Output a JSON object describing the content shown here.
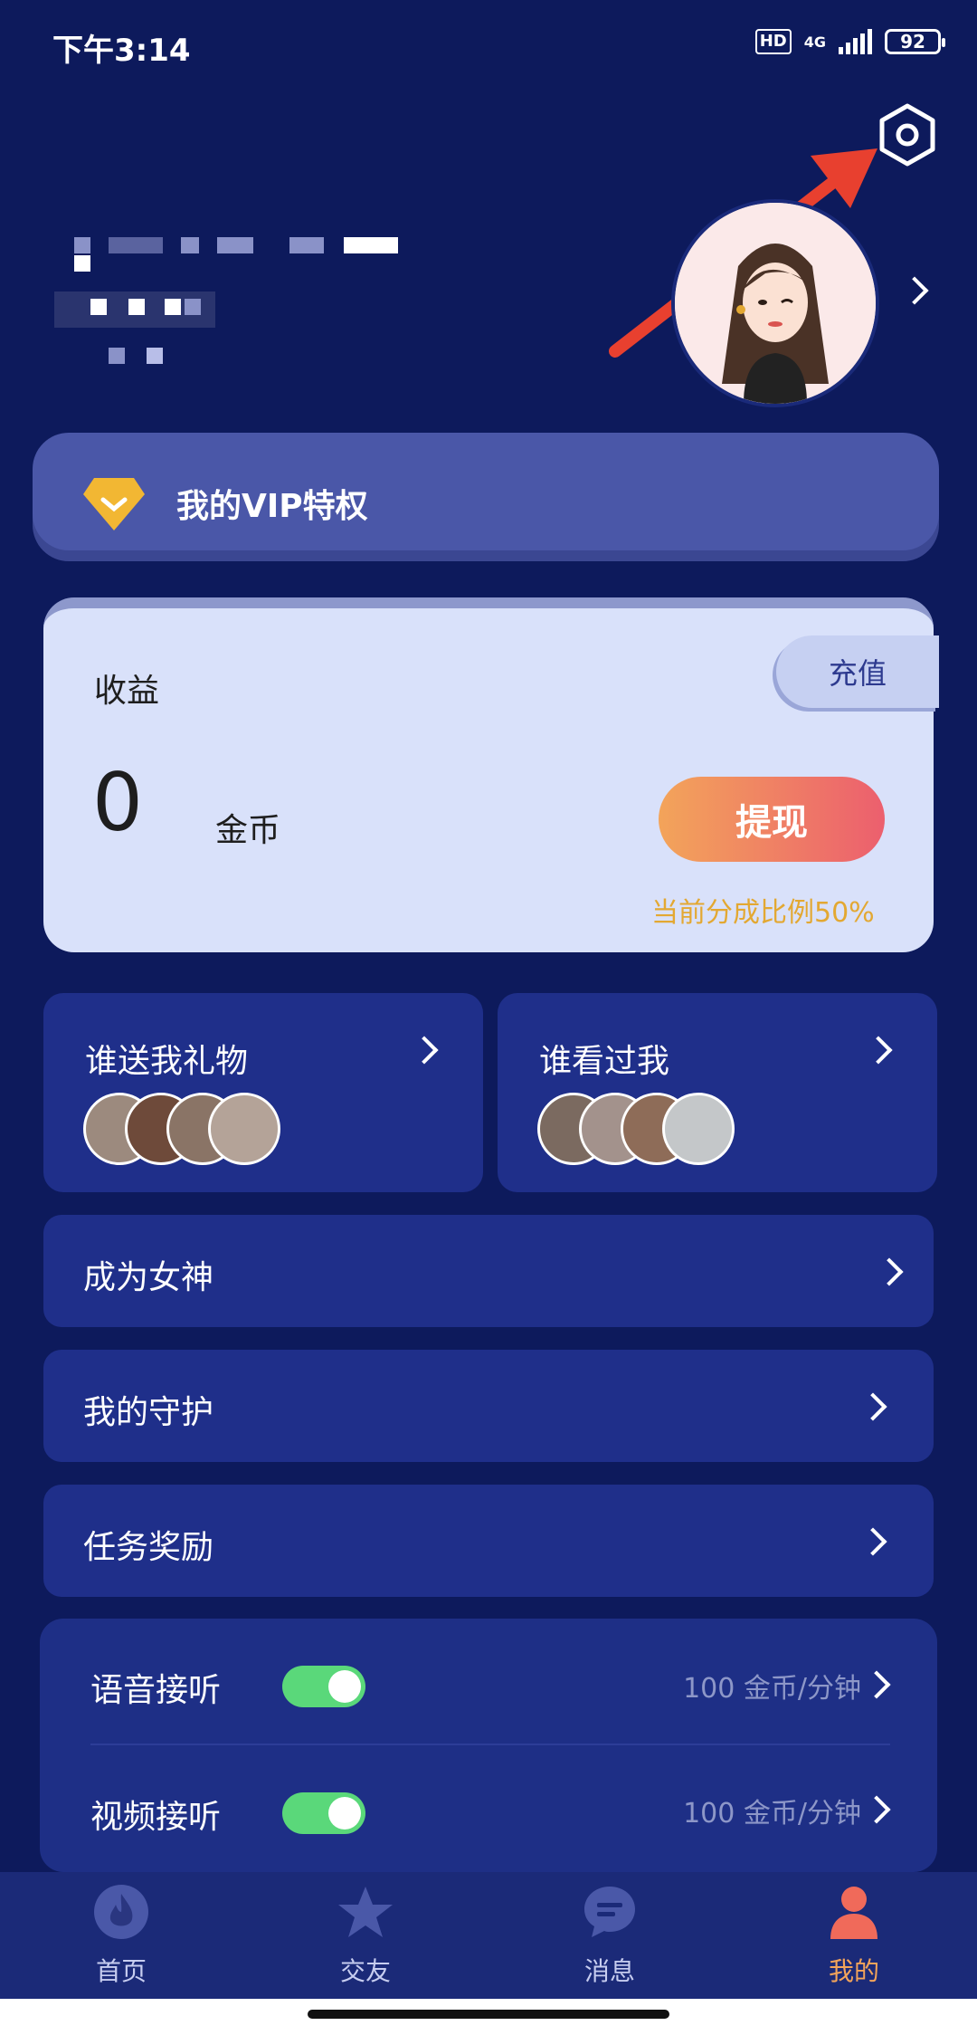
{
  "status": {
    "time": "下午3:14",
    "hd": "HD",
    "network": "4G",
    "battery": "92"
  },
  "vip": {
    "label": "我的VIP特权"
  },
  "earnings": {
    "title": "收益",
    "value": "0",
    "unit": "金币",
    "recharge_label": "充值",
    "withdraw_label": "提现",
    "share_ratio": "当前分成比例50%"
  },
  "cards": [
    {
      "title": "谁送我礼物"
    },
    {
      "title": "谁看过我"
    }
  ],
  "rows": [
    {
      "label": "成为女神"
    },
    {
      "label": "我的守护"
    },
    {
      "label": "任务奖励"
    }
  ],
  "toggles": [
    {
      "label": "语音接听",
      "on": true,
      "price": "100 金币/分钟"
    },
    {
      "label": "视频接听",
      "on": true,
      "price": "100 金币/分钟"
    }
  ],
  "nav": [
    {
      "label": "首页",
      "icon": "fire-icon"
    },
    {
      "label": "交友",
      "icon": "star-icon"
    },
    {
      "label": "消息",
      "icon": "chat-icon"
    },
    {
      "label": "我的",
      "icon": "user-icon"
    }
  ],
  "colors": {
    "background": "#0d1a5c",
    "accent": "#ec5f6e",
    "toggle_on": "#5ad87a",
    "gold": "#e3a832"
  }
}
